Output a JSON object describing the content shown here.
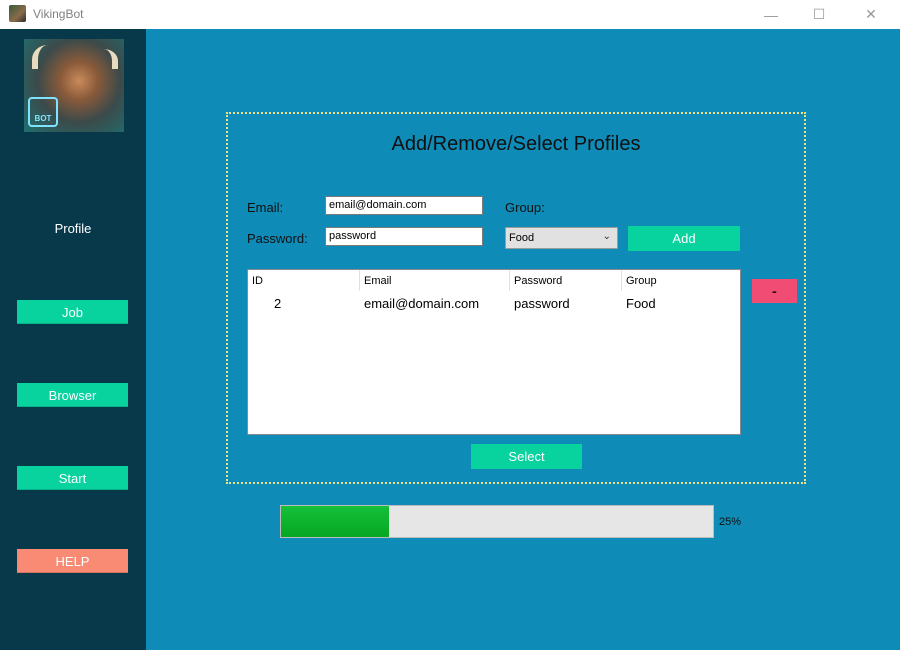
{
  "window": {
    "title": "VikingBot",
    "minimize": "—",
    "maximize": "☐",
    "close": "✕"
  },
  "sidebar": {
    "logo_text": "BOT",
    "profile_label": "Profile",
    "buttons": {
      "job": "Job",
      "browser": "Browser",
      "start": "Start",
      "help": "HELP"
    }
  },
  "main": {
    "title": "Add/Remove/Select Profiles",
    "email_label": "Email:",
    "email_value": "email@domain.com",
    "password_label": "Password:",
    "password_value": "password",
    "group_label": "Group:",
    "group_selected": "Food",
    "add_label": "Add",
    "remove_label": "-",
    "select_label": "Select",
    "table": {
      "columns": [
        "ID",
        "Email",
        "Password",
        "Group"
      ],
      "rows": [
        [
          "2",
          "email@domain.com",
          "password",
          "Food"
        ]
      ]
    },
    "progress": {
      "value": 25,
      "label": "25%"
    }
  },
  "colors": {
    "background": "#0e8bb6",
    "sidebar": "#08394b",
    "accent": "#08d29e",
    "danger": "#f14c74",
    "help": "#f98a74",
    "progress": "#15c03a"
  }
}
